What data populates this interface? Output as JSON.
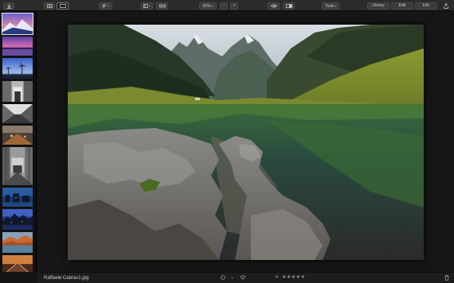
{
  "toolbar": {
    "zoom_value": "56%",
    "zoom_minus": "−",
    "zoom_plus": "+",
    "tools_label": "Tools",
    "library_label": "Library",
    "edit_label": "Edit",
    "info_label": "Info"
  },
  "filmstrip": {
    "selected_index": 0,
    "thumbnails": [
      "snowy-mountain-sunset",
      "purple-lake-sunset",
      "palm-beach-sunset",
      "street-night-scene",
      "pier-perspective",
      "city-street-blur",
      "tram-street",
      "tram-street-2",
      "blue-canal-scene",
      "city-blue-hour",
      "autumn-lake-view",
      "road-city-lights",
      "lake-mountains-blue"
    ]
  },
  "bottombar": {
    "filename": "Raffaele Cabras1.jpg",
    "rating_stars": "★★★★★",
    "flag_symbol": "✕"
  }
}
